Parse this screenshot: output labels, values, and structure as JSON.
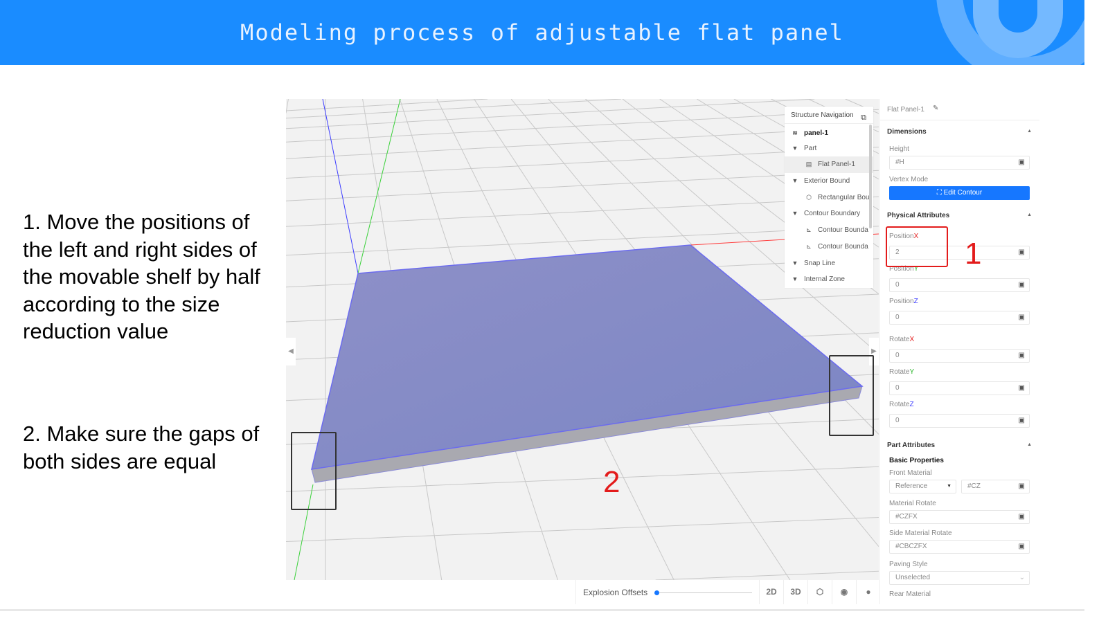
{
  "header": {
    "title": "Modeling process of adjustable flat panel"
  },
  "instructions": [
    "1. Move the positions of the left and right sides of the movable shelf by half according to the size reduction value",
    "2. Make sure the gaps of both sides are equal"
  ],
  "annotations": {
    "marker_1": "1",
    "marker_2": "2"
  },
  "structure_nav": {
    "title": "Structure Navigation",
    "items": [
      {
        "label": "panel-1",
        "icon": "layers-icon"
      },
      {
        "label": "Part",
        "icon": "caret-down-icon"
      },
      {
        "label": "Flat Panel-1",
        "icon": "panel-icon"
      },
      {
        "label": "Exterior Bound",
        "icon": "caret-down-icon"
      },
      {
        "label": "Rectangular Bou",
        "icon": "cube-icon"
      },
      {
        "label": "Contour Boundary",
        "icon": "caret-down-icon"
      },
      {
        "label": "Contour Bounda",
        "icon": "contour-icon"
      },
      {
        "label": "Contour Bounda",
        "icon": "contour-icon"
      },
      {
        "label": "Snap Line",
        "icon": "caret-down-icon"
      },
      {
        "label": "Internal Zone",
        "icon": "caret-down-icon"
      }
    ]
  },
  "toolbar": {
    "explosion_label": "Explosion Offsets",
    "explosion_value": 0,
    "btn_2d": "2D",
    "btn_3d": "3D"
  },
  "properties": {
    "title": "Flat Panel-1",
    "dimensions": {
      "title": "Dimensions",
      "height_label": "Height",
      "height_value": "#H",
      "vertex_label": "Vertex Mode",
      "edit_contour": "Edit Contour"
    },
    "physical": {
      "title": "Physical Attributes",
      "position_x_label": "Position",
      "x": "X",
      "position_x": "2",
      "position_y_label": "Position",
      "y": "Y",
      "position_y": "0",
      "position_z_label": "Position",
      "z": "Z",
      "position_z": "0",
      "rotate_x_label": "Rotate",
      "rotate_x": "0",
      "rotate_y_label": "Rotate",
      "rotate_y": "0",
      "rotate_z_label": "Rotate",
      "rotate_z": "0"
    },
    "part": {
      "title": "Part Attributes",
      "basic": "Basic Properties",
      "front_material_label": "Front Material",
      "front_material_select": "Reference",
      "front_material_value": "#CZ",
      "material_rotate_label": "Material Rotate",
      "material_rotate": "#CZFX",
      "side_material_rotate_label": "Side Material Rotate",
      "side_material_rotate": "#CBCZFX",
      "paving_style_label": "Paving Style",
      "paving_style": "Unselected",
      "rear_material_label": "Rear Material"
    }
  },
  "colors": {
    "header": "#1a8cff",
    "accent": "#1677ff",
    "annotation": "#e31b1b",
    "axis_x": "#ff3b3b",
    "axis_y": "#3ad13a",
    "axis_z": "#3b3bff"
  }
}
